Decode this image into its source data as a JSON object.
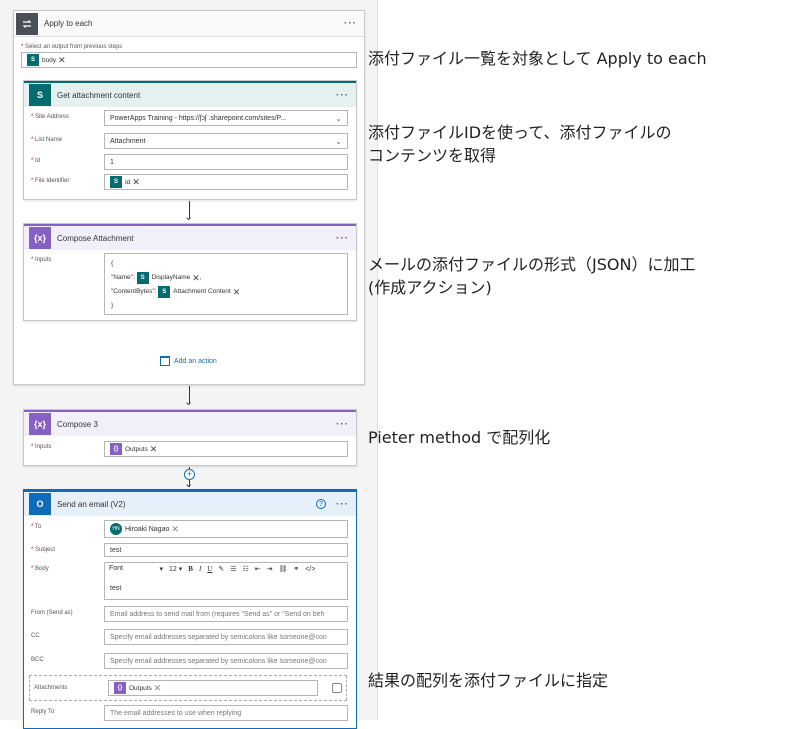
{
  "apply": {
    "title": "Apply to each",
    "select_label": "Select an output from previous steps",
    "token": "body"
  },
  "get_attachment": {
    "title": "Get attachment content",
    "site_label": "Site Address",
    "site_value": "PowerApps Training - https://ʃɔʃ          .sharepoint.com/sites/P...",
    "list_label": "List Name",
    "list_value": "Attachment",
    "id_label": "Id",
    "id_value": "1",
    "file_label": "File Identifier",
    "file_token": "Id"
  },
  "compose_attachment": {
    "title": "Compose Attachment",
    "inputs_label": "Inputs",
    "line1": "{",
    "line2_key": "\"Name\":",
    "line2_token": "DisplayName",
    "line2_tail": ",",
    "line3_key": "\"ContentBytes\":",
    "line3_token": "Attachment Content",
    "line4": "}"
  },
  "add_action": "Add an action",
  "compose3": {
    "title": "Compose 3",
    "inputs_label": "Inputs",
    "token": "Outputs"
  },
  "email": {
    "title": "Send an email (V2)",
    "to_label": "To",
    "to_initials": "HN",
    "to_name": "Hiroaki Nagao",
    "subject_label": "Subject",
    "subject_value": "test",
    "body_label": "Body",
    "font_value": "Font",
    "size_value": "12",
    "body_text": "test",
    "from_label": "From (Send as)",
    "from_placeholder": "Email address to send mail from (requires \"Send as\" or \"Send on beh",
    "cc_label": "CC",
    "cc_placeholder": "Specify email addresses separated by semicolons like someone@con",
    "bcc_label": "BCC",
    "bcc_placeholder": "Specify email addresses separated by semicolons like someone@con",
    "attachments_label": "Attachments",
    "attachments_token": "Outputs",
    "reply_label": "Reply To",
    "reply_placeholder": "The email addresses to use when replying"
  },
  "annotations": {
    "a1": "添付ファイル一覧を対象として Apply to each",
    "a2_line1": "添付ファイルIDを使って、添付ファイルの",
    "a2_line2": "コンテンツを取得",
    "a3_line1": "メールの添付ファイルの形式（JSON）に加工",
    "a3_line2": "(作成アクション)",
    "a4": "Pieter method で配列化",
    "a5": "結果の配列を添付ファイルに指定"
  },
  "colors": {
    "sharepoint": "#036c70",
    "compose": "#8661c5",
    "outlook": "#0f6cbd",
    "loop": "#484f58"
  },
  "icons": [
    "loop-icon",
    "sharepoint-icon",
    "compose-icon",
    "outlook-icon",
    "help-icon",
    "add-action-icon",
    "plus-icon"
  ]
}
